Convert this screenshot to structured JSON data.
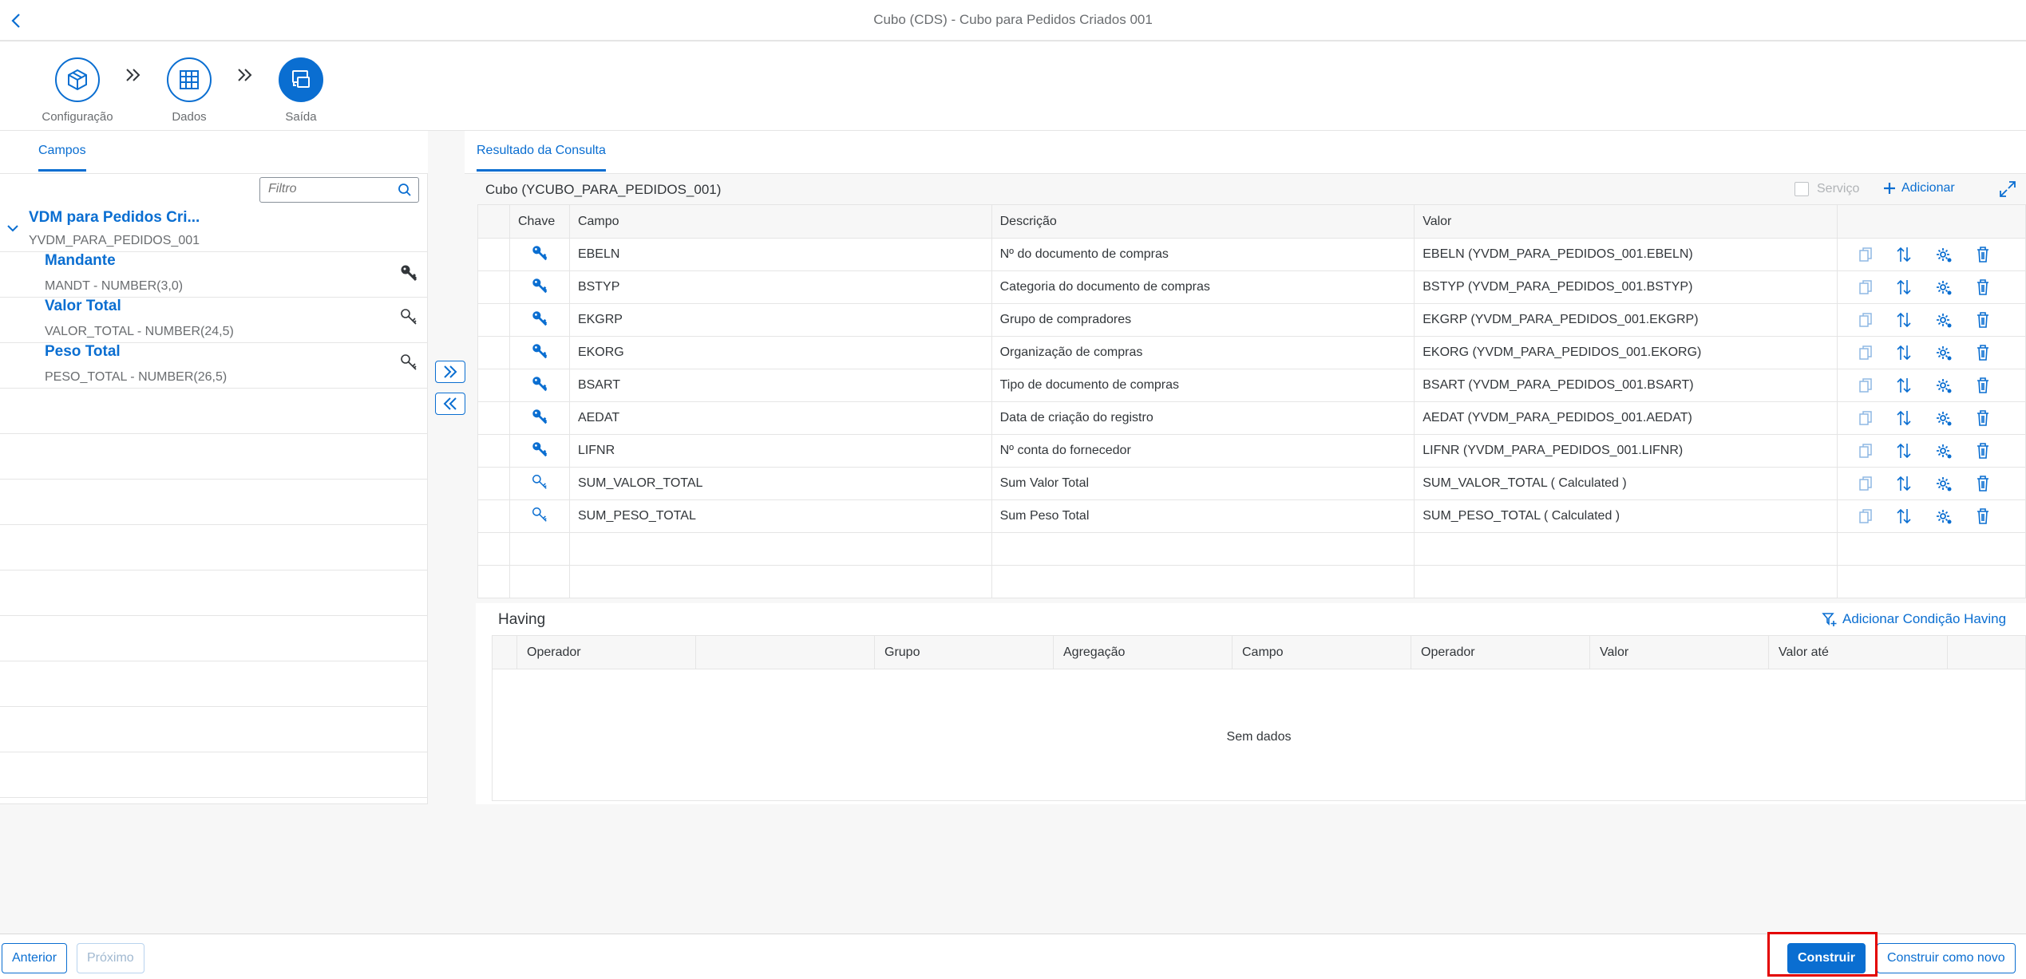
{
  "header": {
    "title": "Cubo (CDS) - Cubo para Pedidos Criados 001"
  },
  "wizard": {
    "steps": [
      {
        "label": "Configuração",
        "icon": "cube-icon",
        "active": false
      },
      {
        "label": "Dados",
        "icon": "table-grid-icon",
        "active": false
      },
      {
        "label": "Saída",
        "icon": "output-icon",
        "active": true
      }
    ]
  },
  "left": {
    "tab": "Campos",
    "filter_placeholder": "Filtro",
    "tree": {
      "root": {
        "title": "VDM para Pedidos Cri...",
        "subtitle": "YVDM_PARA_PEDIDOS_001"
      },
      "items": [
        {
          "title": "Mandante",
          "subtitle": "MANDT - NUMBER(3,0)",
          "key": "filled"
        },
        {
          "title": "Valor Total",
          "subtitle": "VALOR_TOTAL - NUMBER(24,5)",
          "key": "outline"
        },
        {
          "title": "Peso Total",
          "subtitle": "PESO_TOTAL - NUMBER(26,5)",
          "key": "outline"
        }
      ]
    }
  },
  "right": {
    "tab": "Resultado da Consulta",
    "cube_name": "Cubo (YCUBO_PARA_PEDIDOS_001)",
    "servico_label": "Serviço",
    "add_label": "Adicionar",
    "columns": [
      "Chave",
      "Campo",
      "Descrição",
      "Valor"
    ],
    "rows": [
      {
        "key": "filled",
        "campo": "EBELN",
        "descricao": "Nº do documento de compras",
        "valor": "EBELN (YVDM_PARA_PEDIDOS_001.EBELN)"
      },
      {
        "key": "filled",
        "campo": "BSTYP",
        "descricao": "Categoria do documento de compras",
        "valor": "BSTYP (YVDM_PARA_PEDIDOS_001.BSTYP)"
      },
      {
        "key": "filled",
        "campo": "EKGRP",
        "descricao": "Grupo de compradores",
        "valor": "EKGRP (YVDM_PARA_PEDIDOS_001.EKGRP)"
      },
      {
        "key": "filled",
        "campo": "EKORG",
        "descricao": "Organização de compras",
        "valor": "EKORG (YVDM_PARA_PEDIDOS_001.EKORG)"
      },
      {
        "key": "filled",
        "campo": "BSART",
        "descricao": "Tipo de documento de compras",
        "valor": "BSART (YVDM_PARA_PEDIDOS_001.BSART)"
      },
      {
        "key": "filled",
        "campo": "AEDAT",
        "descricao": "Data de criação do registro",
        "valor": "AEDAT (YVDM_PARA_PEDIDOS_001.AEDAT)"
      },
      {
        "key": "filled",
        "campo": "LIFNR",
        "descricao": "Nº conta do fornecedor",
        "valor": "LIFNR (YVDM_PARA_PEDIDOS_001.LIFNR)"
      },
      {
        "key": "outline",
        "campo": "SUM_VALOR_TOTAL",
        "descricao": "Sum Valor Total",
        "valor": "SUM_VALOR_TOTAL ( Calculated )"
      },
      {
        "key": "outline",
        "campo": "SUM_PESO_TOTAL",
        "descricao": "Sum Peso Total",
        "valor": "SUM_PESO_TOTAL ( Calculated )"
      }
    ],
    "having": {
      "label": "Having",
      "add_label": "Adicionar Condição Having",
      "columns": [
        "Operador",
        "Grupo",
        "Agregação",
        "Campo",
        "Operador",
        "Valor",
        "Valor até"
      ],
      "empty_text": "Sem dados"
    }
  },
  "footer": {
    "prev_label": "Anterior",
    "next_label": "Próximo",
    "build_label": "Construir",
    "build_new_label": "Construir como novo"
  },
  "colors": {
    "accent": "#0a6ed1",
    "highlight": "#e30000"
  }
}
